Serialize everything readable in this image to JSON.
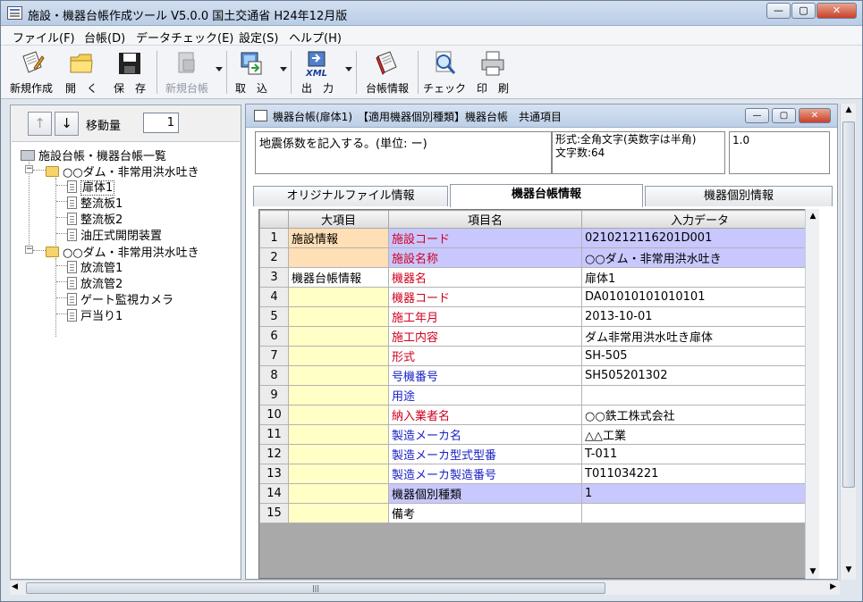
{
  "window": {
    "title": "施設・機器台帳作成ツール V5.0.0 国土交通省 H24年12月版",
    "controls": {
      "minimize": "—",
      "maximize": "▢",
      "close": "✕"
    }
  },
  "menu": [
    "ファイル(F)",
    "台帳(D)",
    "データチェック(E)",
    "設定(S)",
    "ヘルプ(H)"
  ],
  "toolbar": [
    {
      "label": "新規作成",
      "icon": "new-file-icon",
      "enabled": true
    },
    {
      "label": "開　く",
      "icon": "open-folder-icon",
      "enabled": true
    },
    {
      "label": "保　存",
      "icon": "save-disk-icon",
      "enabled": true
    },
    {
      "label": "新規台帳",
      "icon": "new-ledger-icon",
      "enabled": false
    },
    {
      "label": "取　込",
      "icon": "import-icon",
      "enabled": true
    },
    {
      "label": "出　力",
      "icon": "export-xml-icon",
      "enabled": true
    },
    {
      "label": "台帳情報",
      "icon": "ledger-info-icon",
      "enabled": true
    },
    {
      "label": "チェック",
      "icon": "check-magnifier-icon",
      "enabled": true
    },
    {
      "label": "印　刷",
      "icon": "printer-icon",
      "enabled": true
    }
  ],
  "left_panel": {
    "up_arrow": "↑",
    "down_arrow": "↓",
    "move_label": "移動量",
    "move_value": "1",
    "tree": {
      "root": "施設台帳・機器台帳一覧",
      "groups": [
        {
          "label": "○○ダム・非常用洪水吐き",
          "children": [
            "扉体1",
            "整流板1",
            "整流板2",
            "油圧式開閉装置"
          ]
        },
        {
          "label": "○○ダム・非常用洪水吐き",
          "children": [
            "放流管1",
            "放流管2",
            "ゲート監視カメラ",
            "戸当り1"
          ]
        }
      ],
      "selected": "扉体1"
    }
  },
  "child_window": {
    "title": "機器台帳(扉体1)　【適用機器個別種類】機器台帳　共通項目",
    "controls": {
      "minimize": "—",
      "maximize": "▢",
      "close": "✕"
    },
    "info_text": "地震係数を記入する。(単位: ー)",
    "format_text": "形式:全角文字(英数字は半角)",
    "length_text": "文字数:64",
    "value_text": "1.0",
    "tabs": [
      "オリジナルファイル情報",
      "機器台帳情報",
      "機器個別情報"
    ],
    "active_tab": "機器台帳情報",
    "columns": [
      "",
      "大項目",
      "項目名",
      "入力データ"
    ],
    "rows": [
      {
        "no": "1",
        "category": "施設情報",
        "cat_bg": "peach",
        "item": "施設コード",
        "kind": "req",
        "value": "0210212116201D001",
        "hl": true
      },
      {
        "no": "2",
        "category": "",
        "cat_bg": "peach",
        "item": "施設名称",
        "kind": "req",
        "value": "○○ダム・非常用洪水吐き",
        "hl": true
      },
      {
        "no": "3",
        "category": "機器台帳情報",
        "cat_bg": "white",
        "item": "機器名",
        "kind": "req",
        "value": "扉体1",
        "hl": false
      },
      {
        "no": "4",
        "category": "",
        "cat_bg": "yellow",
        "item": "機器コード",
        "kind": "req",
        "value": "DA01010101010101",
        "hl": false
      },
      {
        "no": "5",
        "category": "",
        "cat_bg": "yellow",
        "item": "施工年月",
        "kind": "req",
        "value": "2013-10-01",
        "hl": false
      },
      {
        "no": "6",
        "category": "",
        "cat_bg": "yellow",
        "item": "施工内容",
        "kind": "req",
        "value": "ダム非常用洪水吐き扉体",
        "hl": false
      },
      {
        "no": "7",
        "category": "",
        "cat_bg": "yellow",
        "item": "形式",
        "kind": "req",
        "value": "SH-505",
        "hl": false
      },
      {
        "no": "8",
        "category": "",
        "cat_bg": "yellow",
        "item": "号機番号",
        "kind": "opt",
        "value": "SH505201302",
        "hl": false
      },
      {
        "no": "9",
        "category": "",
        "cat_bg": "yellow",
        "item": "用途",
        "kind": "opt",
        "value": "",
        "hl": false
      },
      {
        "no": "10",
        "category": "",
        "cat_bg": "yellow",
        "item": "納入業者名",
        "kind": "req",
        "value": "○○鉄工株式会社",
        "hl": false
      },
      {
        "no": "11",
        "category": "",
        "cat_bg": "yellow",
        "item": "製造メーカ名",
        "kind": "opt",
        "value": "△△工業",
        "hl": false
      },
      {
        "no": "12",
        "category": "",
        "cat_bg": "yellow",
        "item": "製造メーカ型式型番",
        "kind": "opt",
        "value": "T-011",
        "hl": false
      },
      {
        "no": "13",
        "category": "",
        "cat_bg": "yellow",
        "item": "製造メーカ製造番号",
        "kind": "opt",
        "value": "T011034221",
        "hl": false
      },
      {
        "no": "14",
        "category": "",
        "cat_bg": "yellow",
        "item": "機器個別種類",
        "kind": "plain",
        "value": "1",
        "hl": true
      },
      {
        "no": "15",
        "category": "",
        "cat_bg": "yellow",
        "item": "備考",
        "kind": "plain",
        "value": "",
        "hl": false
      }
    ]
  },
  "scrollbars": {
    "up": "▲",
    "down": "▼",
    "left": "◀",
    "right": "▶",
    "grip": "|||"
  }
}
